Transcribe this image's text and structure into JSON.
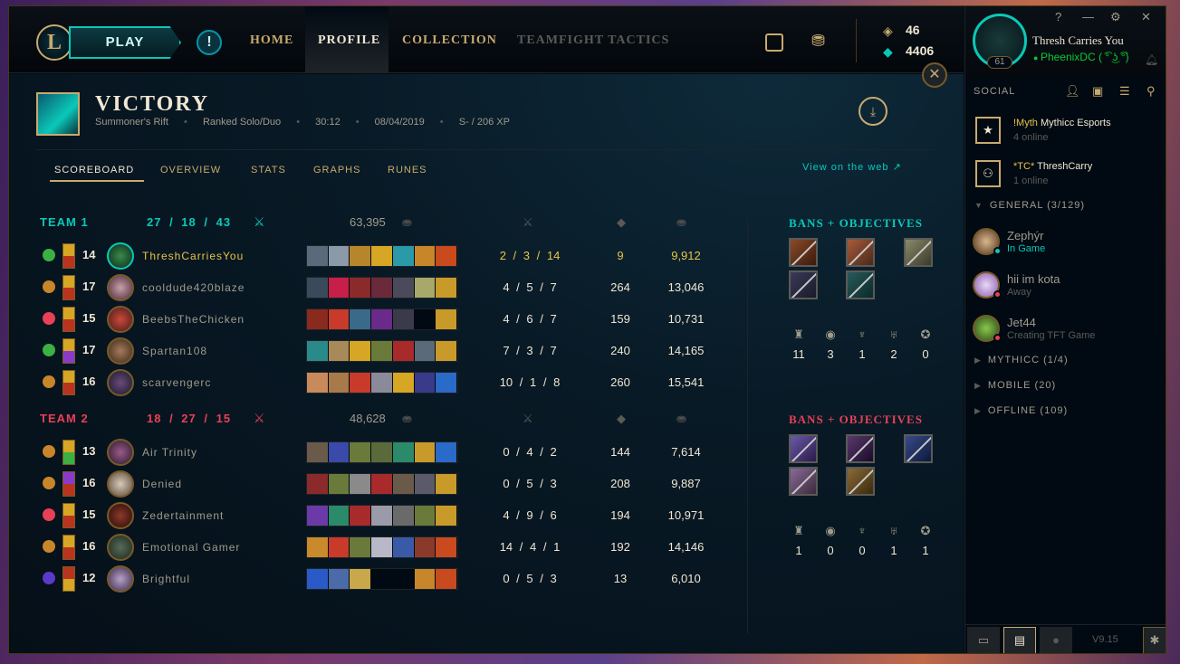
{
  "nav": {
    "logo": "L",
    "play": "PLAY",
    "alert": "!",
    "home": "HOME",
    "profile": "PROFILE",
    "collection": "COLLECTION",
    "tft": "TEAMFIGHT TACTICS",
    "rp": "46",
    "be": "4406",
    "close": "✕"
  },
  "match": {
    "result": "VICTORY",
    "map": "Summoner's Rift",
    "queue": "Ranked Solo/Duo",
    "duration": "30:12",
    "date": "08/04/2019",
    "xp": "S- / 206 XP",
    "download": "⤓"
  },
  "tabs": [
    "SCOREBOARD",
    "OVERVIEW",
    "STATS",
    "GRAPHS",
    "RUNES"
  ],
  "view_web": "View on the web ↗",
  "team1": {
    "label": "TEAM 1",
    "kda": "27 / 18 / 43",
    "gold": "63,395",
    "bans_label": "BANS + OBJECTIVES",
    "objectives": [
      "11",
      "3",
      "1",
      "2",
      "0"
    ],
    "players": [
      {
        "level": "14",
        "name": "ThreshCarriesYou",
        "kda": "2 / 3 / 14",
        "cs": "9",
        "gold": "9,912"
      },
      {
        "level": "17",
        "name": "cooldude420blaze",
        "kda": "4 / 5 / 7",
        "cs": "264",
        "gold": "13,046"
      },
      {
        "level": "15",
        "name": "BeebsTheChicken",
        "kda": "4 / 6 / 7",
        "cs": "159",
        "gold": "10,731"
      },
      {
        "level": "17",
        "name": "Spartan108",
        "kda": "7 / 3 / 7",
        "cs": "240",
        "gold": "14,165"
      },
      {
        "level": "16",
        "name": "scarvengerc",
        "kda": "10 / 1 / 8",
        "cs": "260",
        "gold": "15,541"
      }
    ]
  },
  "team2": {
    "label": "TEAM 2",
    "kda": "18 / 27 / 15",
    "gold": "48,628",
    "bans_label": "BANS + OBJECTIVES",
    "objectives": [
      "1",
      "0",
      "0",
      "1",
      "1"
    ],
    "players": [
      {
        "level": "13",
        "name": "Air Trinity",
        "kda": "0 / 4 / 2",
        "cs": "144",
        "gold": "7,614"
      },
      {
        "level": "16",
        "name": "Denied",
        "kda": "0 / 5 / 3",
        "cs": "208",
        "gold": "9,887"
      },
      {
        "level": "15",
        "name": "Zedertainment",
        "kda": "4 / 9 / 6",
        "cs": "194",
        "gold": "10,971"
      },
      {
        "level": "16",
        "name": "Emotional Gamer",
        "kda": "14 / 4 / 1",
        "cs": "192",
        "gold": "14,146"
      },
      {
        "level": "12",
        "name": "Brightful",
        "kda": "0 / 5 / 3",
        "cs": "13",
        "gold": "6,010"
      }
    ]
  },
  "social": {
    "summoner": "Thresh Carries You",
    "level": "61",
    "status": "PheenixDC ( ͡° ͜ʖ ͡°)",
    "title": "SOCIAL",
    "clubs": [
      {
        "tag": "!Myth",
        "name": "Mythicc Esports",
        "online": "4 online"
      },
      {
        "tag": "*TC*",
        "name": "ThreshCarry",
        "online": "1 online"
      }
    ],
    "general": "GENERAL (3/129)",
    "friends": [
      {
        "name": "Zephýr",
        "status": "In Game"
      },
      {
        "name": "hii im kota",
        "status": "Away"
      },
      {
        "name": "Jet44",
        "status": "Creating TFT Game"
      }
    ],
    "groups": [
      "MYTHICC (1/4)",
      "MOBILE (20)",
      "OFFLINE (109)"
    ],
    "version": "V9.15"
  },
  "colors": {
    "gold": "#c8aa6e",
    "teal": "#0ac8b9",
    "red": "#e84057",
    "highlight": "#e8c34a"
  }
}
